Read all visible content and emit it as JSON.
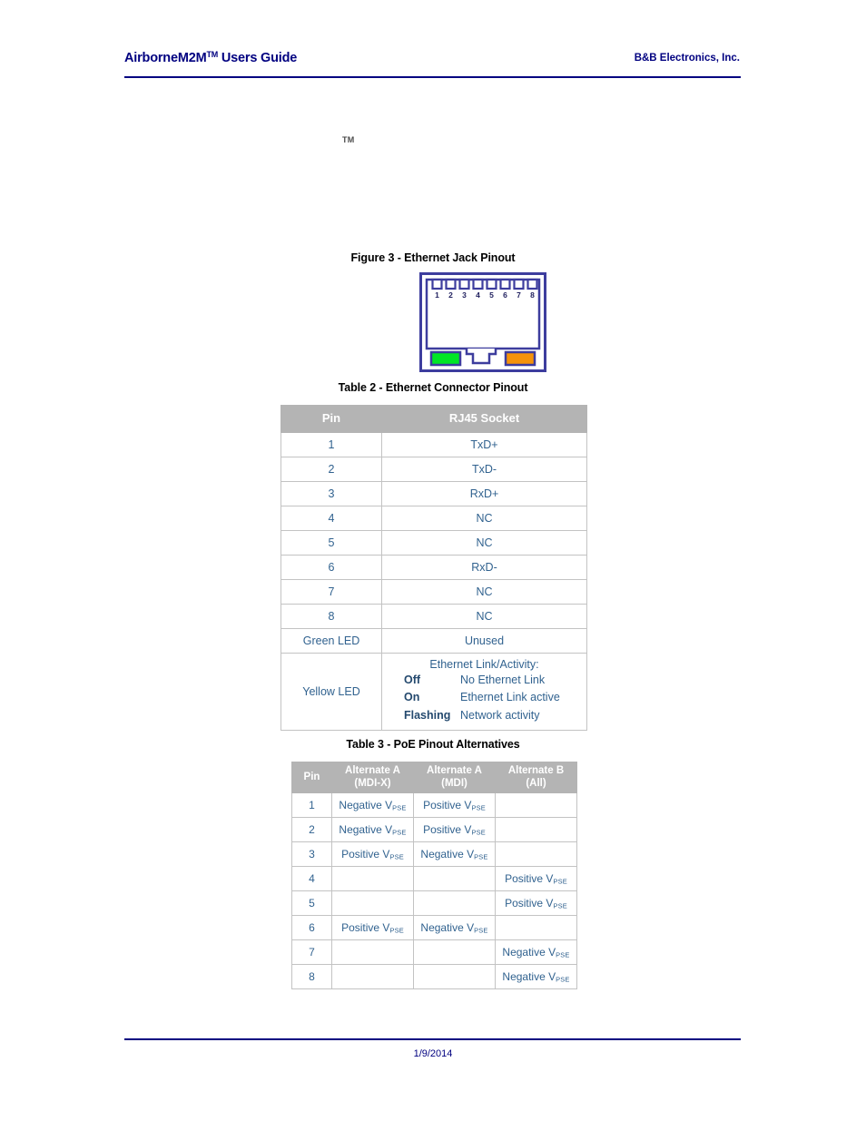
{
  "header": {
    "title": "AirborneM2M",
    "title_tm": "TM",
    "title_suffix": " Users Guide",
    "company": "B&B Electronics, Inc.",
    "rule_color": "#000080"
  },
  "stray_marks": {
    "tm": "TM"
  },
  "figure": {
    "caption": "Figure 3 - Ethernet Jack Pinout",
    "jack": {
      "pin_labels": [
        "1",
        "2",
        "3",
        "4",
        "5",
        "6",
        "7",
        "8"
      ],
      "led_left_name": "green-led",
      "led_left_color": "#00e625",
      "led_right_name": "orange-led",
      "led_right_color": "#f5930a",
      "outline_color": "#3d3d9e"
    }
  },
  "table2": {
    "caption": "Table 2 - Ethernet Connector Pinout",
    "headers": [
      "Pin",
      "RJ45 Socket"
    ],
    "rows": [
      {
        "pin": "1",
        "signal": "TxD+"
      },
      {
        "pin": "2",
        "signal": "TxD-"
      },
      {
        "pin": "3",
        "signal": "RxD+"
      },
      {
        "pin": "4",
        "signal": "NC"
      },
      {
        "pin": "5",
        "signal": "NC"
      },
      {
        "pin": "6",
        "signal": "RxD-"
      },
      {
        "pin": "7",
        "signal": "NC"
      },
      {
        "pin": "8",
        "signal": "NC"
      },
      {
        "pin": "Green LED",
        "signal": "Unused"
      }
    ],
    "yellow_led": {
      "pin": "Yellow LED",
      "title": "Ethernet Link/Activity:",
      "states": [
        {
          "state": "Off",
          "desc": "No Ethernet Link"
        },
        {
          "state": "On",
          "desc": "Ethernet Link active"
        },
        {
          "state": "Flashing",
          "desc": "Network activity"
        }
      ]
    }
  },
  "table3": {
    "caption": "Table 3 - PoE Pinout Alternatives",
    "headers": [
      {
        "line1": "Pin",
        "line2": ""
      },
      {
        "line1": "Alternate A",
        "line2": "(MDI-X)"
      },
      {
        "line1": "Alternate A",
        "line2": "(MDI)"
      },
      {
        "line1": "Alternate B",
        "line2": "(All)"
      }
    ],
    "v_symbol": "V",
    "v_sub": "PSE",
    "rows": [
      {
        "pin": "1",
        "alt_a_mdix": "Negative V",
        "alt_a_mdi": "Positive V",
        "alt_b_all": ""
      },
      {
        "pin": "2",
        "alt_a_mdix": "Negative V",
        "alt_a_mdi": "Positive V",
        "alt_b_all": ""
      },
      {
        "pin": "3",
        "alt_a_mdix": "Positive V",
        "alt_a_mdi": "Negative V",
        "alt_b_all": ""
      },
      {
        "pin": "4",
        "alt_a_mdix": "",
        "alt_a_mdi": "",
        "alt_b_all": "Positive V"
      },
      {
        "pin": "5",
        "alt_a_mdix": "",
        "alt_a_mdi": "",
        "alt_b_all": "Positive V"
      },
      {
        "pin": "6",
        "alt_a_mdix": "Positive V",
        "alt_a_mdi": "Negative V",
        "alt_b_all": ""
      },
      {
        "pin": "7",
        "alt_a_mdix": "",
        "alt_a_mdi": "",
        "alt_b_all": "Negative V"
      },
      {
        "pin": "8",
        "alt_a_mdix": "",
        "alt_a_mdi": "",
        "alt_b_all": "Negative V"
      }
    ]
  },
  "footer": {
    "date": "1/9/2014"
  }
}
